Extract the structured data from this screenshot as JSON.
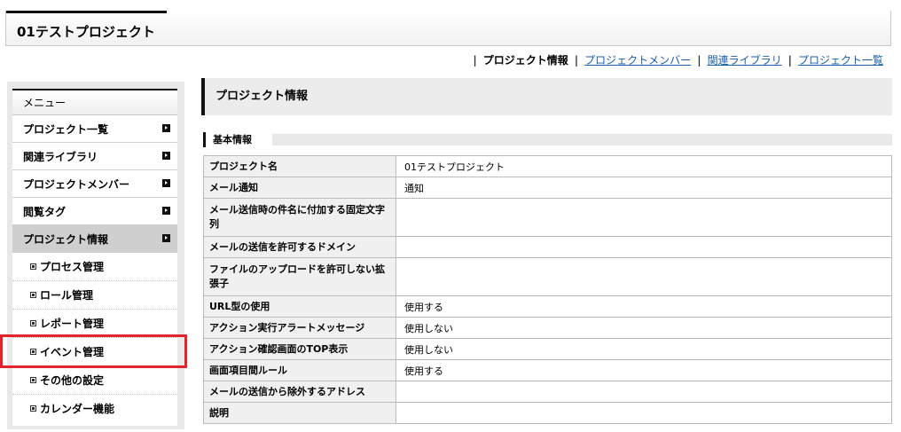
{
  "header": {
    "title": "01テストプロジェクト"
  },
  "top_links": [
    {
      "label": "プロジェクト情報",
      "current": true
    },
    {
      "label": "プロジェクトメンバー",
      "current": false
    },
    {
      "label": "関連ライブラリ",
      "current": false
    },
    {
      "label": "プロジェクト一覧",
      "current": false
    }
  ],
  "sidebar": {
    "title": "メニュー",
    "items": [
      {
        "label": "プロジェクト一覧"
      },
      {
        "label": "関連ライブラリ"
      },
      {
        "label": "プロジェクトメンバー"
      },
      {
        "label": "閲覧タグ"
      },
      {
        "label": "プロジェクト情報"
      }
    ],
    "sub_items": [
      {
        "label": "プロセス管理"
      },
      {
        "label": "ロール管理"
      },
      {
        "label": "レポート管理"
      },
      {
        "label": "イベント管理"
      },
      {
        "label": "その他の設定"
      },
      {
        "label": "カレンダー機能"
      }
    ]
  },
  "main": {
    "page_title": "プロジェクト情報",
    "section_title": "基本情報",
    "rows": [
      {
        "key": "プロジェクト名",
        "value": "01テストプロジェクト"
      },
      {
        "key": "メール通知",
        "value": "通知"
      },
      {
        "key": "メール送信時の件名に付加する固定文字列",
        "value": ""
      },
      {
        "key": "メールの送信を許可するドメイン",
        "value": ""
      },
      {
        "key": "ファイルのアップロードを許可しない拡張子",
        "value": ""
      },
      {
        "key": "URL型の使用",
        "value": "使用する"
      },
      {
        "key": "アクション実行アラートメッセージ",
        "value": "使用しない"
      },
      {
        "key": "アクション確認画面のTOP表示",
        "value": "使用しない"
      },
      {
        "key": "画面項目間ルール",
        "value": "使用する"
      },
      {
        "key": "メールの送信から除外するアドレス",
        "value": ""
      },
      {
        "key": "説明",
        "value": ""
      }
    ]
  },
  "colors": {
    "highlight": "#e3242b",
    "link": "#1a5ea8"
  }
}
